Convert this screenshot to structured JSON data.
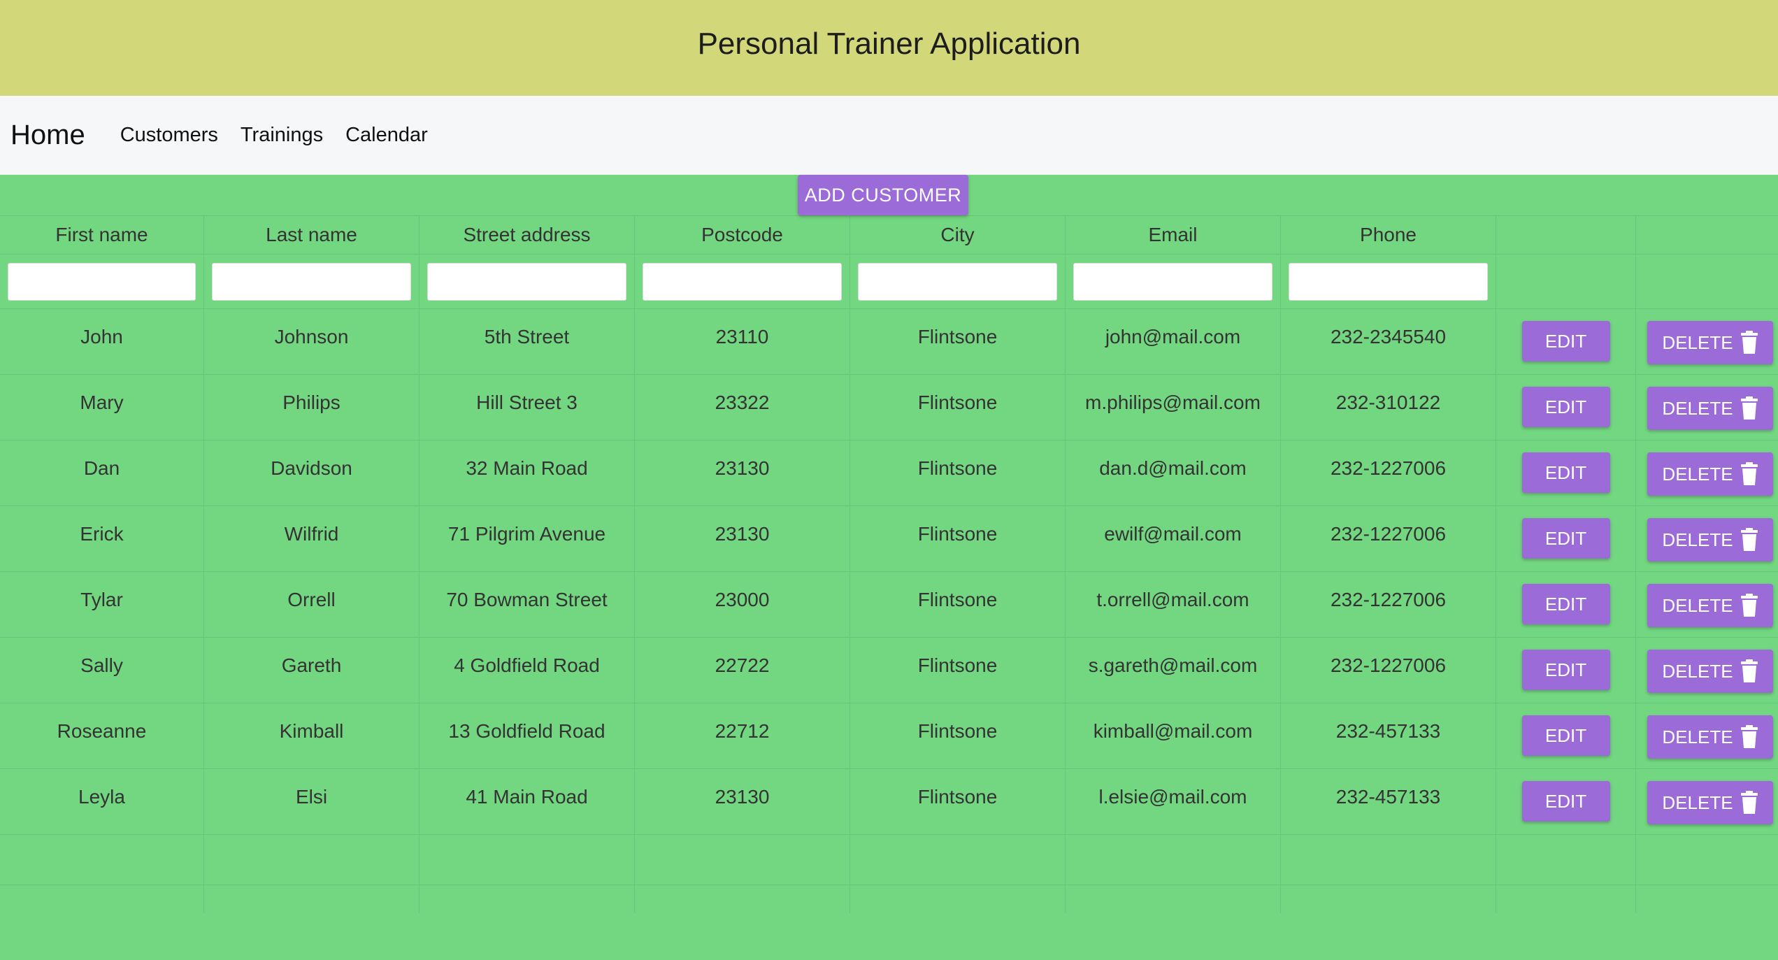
{
  "app": {
    "title": "Personal Trainer Application"
  },
  "nav": {
    "home": "Home",
    "links": [
      "Customers",
      "Trainings",
      "Calendar"
    ]
  },
  "toolbar": {
    "add_customer_label": "ADD CUSTOMER"
  },
  "table": {
    "columns": [
      "First name",
      "Last name",
      "Street address",
      "Postcode",
      "City",
      "Email",
      "Phone"
    ],
    "filters": [
      "",
      "",
      "",
      "",
      "",
      "",
      ""
    ],
    "edit_label": "EDIT",
    "delete_label": "DELETE",
    "delete_icon": "trash-icon",
    "rows": [
      [
        "John",
        "Johnson",
        "5th Street",
        "23110",
        "Flintsone",
        "john@mail.com",
        "232-2345540"
      ],
      [
        "Mary",
        "Philips",
        "Hill Street 3",
        "23322",
        "Flintsone",
        "m.philips@mail.com",
        "232-310122"
      ],
      [
        "Dan",
        "Davidson",
        "32 Main Road",
        "23130",
        "Flintsone",
        "dan.d@mail.com",
        "232-1227006"
      ],
      [
        "Erick",
        "Wilfrid",
        "71 Pilgrim Avenue",
        "23130",
        "Flintsone",
        "ewilf@mail.com",
        "232-1227006"
      ],
      [
        "Tylar",
        "Orrell",
        "70 Bowman Street",
        "23000",
        "Flintsone",
        "t.orrell@mail.com",
        "232-1227006"
      ],
      [
        "Sally",
        "Gareth",
        "4 Goldfield Road",
        "22722",
        "Flintsone",
        "s.gareth@mail.com",
        "232-1227006"
      ],
      [
        "Roseanne",
        "Kimball",
        "13 Goldfield Road",
        "22712",
        "Flintsone",
        "kimball@mail.com",
        "232-457133"
      ],
      [
        "Leyla",
        "Elsi",
        "41 Main Road",
        "23130",
        "Flintsone",
        "l.elsie@mail.com",
        "232-457133"
      ]
    ]
  },
  "colors": {
    "header_bg": "#d2d87a",
    "nav_bg": "#f6f7f9",
    "grid_bg": "#73d680",
    "button_bg": "#9b6bd7",
    "button_text": "#ffffff"
  }
}
